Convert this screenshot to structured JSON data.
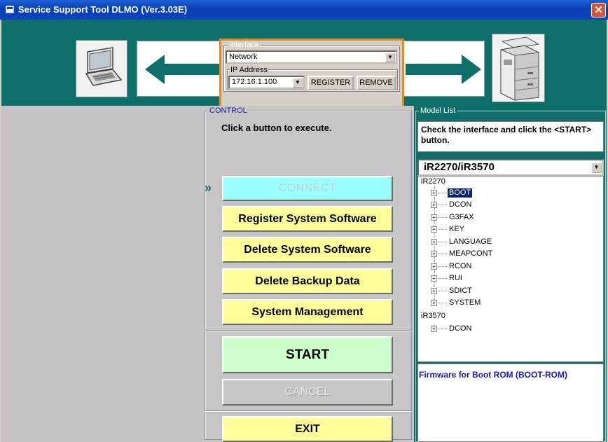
{
  "window": {
    "title": "Service Support Tool DLMO (Ver.3.03E)",
    "close_glyph": "✕"
  },
  "interface": {
    "legend": "Interface",
    "selected": "Network",
    "ip_legend": "IP Address",
    "ip_value": "172.16.1.100",
    "register_label": "REGISTER",
    "remove_label": "REMOVE"
  },
  "control": {
    "legend": "CONTROL",
    "instruction": "Click a button to execute.",
    "indicator": "»",
    "buttons": {
      "connect": "CONNECT",
      "register_system_software": "Register System Software",
      "delete_system_software": "Delete System Software",
      "delete_backup_data": "Delete Backup Data",
      "system_management": "System Management",
      "start": "START",
      "cancel": "CANCEL",
      "exit": "EXIT"
    }
  },
  "model_list": {
    "legend": "Model List",
    "instruction": "Check the interface and click the <START> button.",
    "selected_model": "iR2270/iR3570",
    "tree": {
      "group1": "iR2270",
      "group1_items": [
        "BOOT",
        "DCON",
        "G3FAX",
        "KEY",
        "LANGUAGE",
        "MEAPCONT",
        "RCON",
        "RUI",
        "SDICT",
        "SYSTEM"
      ],
      "group2": "iR3570",
      "group2_items": [
        "DCON"
      ]
    },
    "selected_item": "BOOT",
    "description": "Firmware for Boot ROM (BOOT-ROM)"
  },
  "icons": {
    "laptop": "laptop-icon",
    "printer": "printer-icon",
    "arrow_left": "arrow-left-icon",
    "arrow_right": "arrow-right-icon"
  },
  "colors": {
    "header_teal": "#0e6e6a",
    "interface_border": "#e58a1c",
    "button_yellow": "#ffff99",
    "connect_cyan": "#99ffff",
    "start_green": "#ccffcc",
    "description_blue": "#1a1ab4"
  }
}
